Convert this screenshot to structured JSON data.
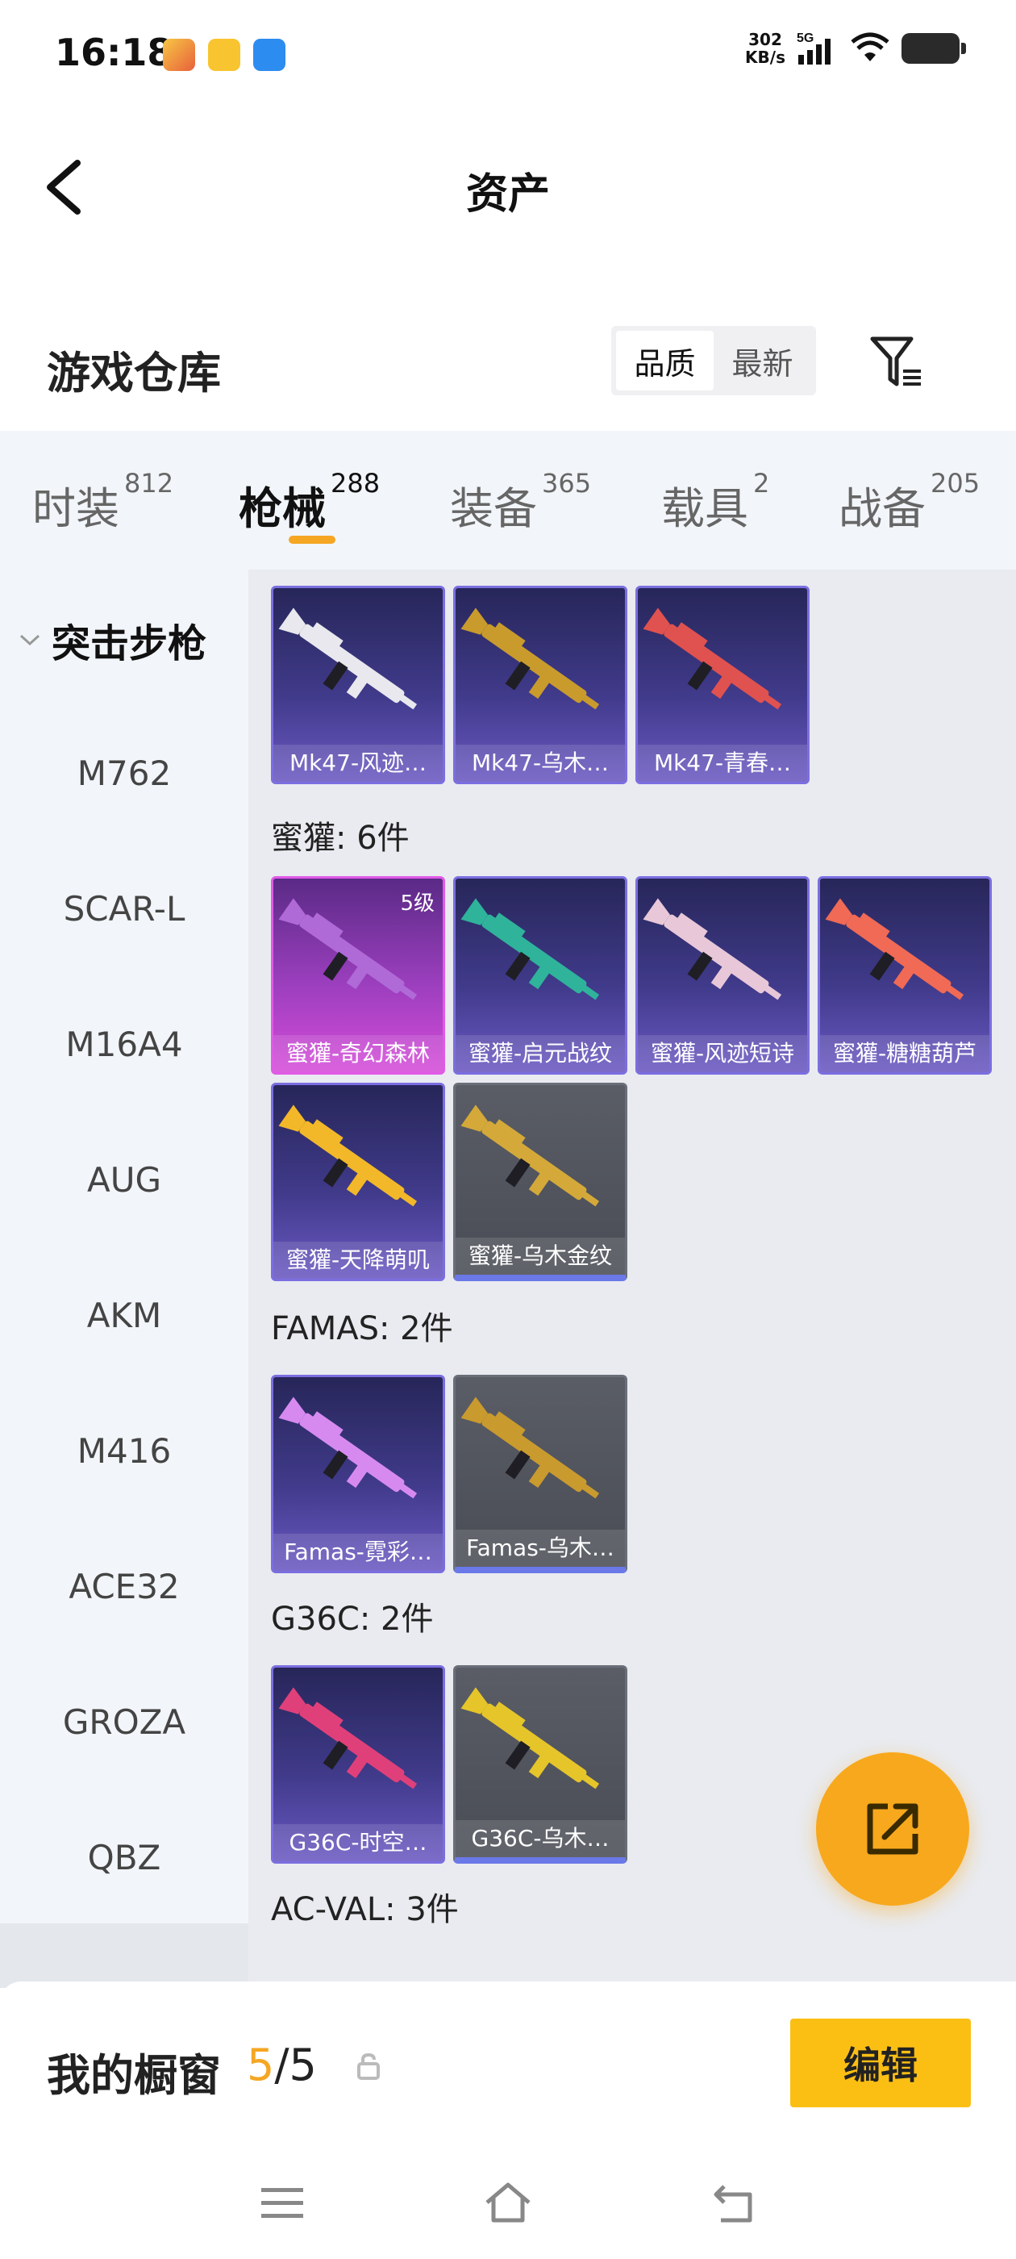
{
  "status": {
    "time": "16:18",
    "net_speed_value": "302",
    "net_speed_unit": "KB/s",
    "network": "5G",
    "app_icons": [
      "app-icon-1",
      "app-icon-2",
      "app-icon-3"
    ]
  },
  "header": {
    "title": "资产",
    "back_icon": "chevron-left-icon"
  },
  "warehouse": {
    "title": "游戏仓库",
    "sort_options": [
      "品质",
      "最新"
    ],
    "sort_selected": "品质",
    "filter_icon": "filter-icon"
  },
  "tabs": [
    {
      "label": "时装",
      "count": "812"
    },
    {
      "label": "枪械",
      "count": "288",
      "active": true
    },
    {
      "label": "装备",
      "count": "365"
    },
    {
      "label": "载具",
      "count": "2"
    },
    {
      "label": "战备",
      "count": "205"
    }
  ],
  "sidenav": {
    "category": "突击步枪",
    "items": [
      "M762",
      "SCAR-L",
      "M16A4",
      "AUG",
      "AKM",
      "M416",
      "ACE32",
      "GROZA",
      "QBZ"
    ]
  },
  "groups": [
    {
      "title": "",
      "items": [
        {
          "name": "Mk47-风迹…",
          "style": "epic"
        },
        {
          "name": "Mk47-乌木…",
          "style": "epic"
        },
        {
          "name": "Mk47-青春…",
          "style": "epic"
        }
      ]
    },
    {
      "title": "蜜獾: 6件",
      "items": [
        {
          "name": "蜜獾-奇幻森林",
          "style": "legend",
          "level": "5级"
        },
        {
          "name": "蜜獾-启元战纹",
          "style": "epic"
        },
        {
          "name": "蜜獾-风迹短诗",
          "style": "epic"
        },
        {
          "name": "蜜獾-糖糖葫芦",
          "style": "epic"
        },
        {
          "name": "蜜獾-天降萌叽",
          "style": "epic"
        },
        {
          "name": "蜜獾-乌木金纹",
          "style": "gray"
        }
      ]
    },
    {
      "title": "FAMAS: 2件",
      "items": [
        {
          "name": "Famas-霓彩…",
          "style": "epic"
        },
        {
          "name": "Famas-乌木…",
          "style": "gray"
        }
      ]
    },
    {
      "title": "G36C: 2件",
      "items": [
        {
          "name": "G36C-时空…",
          "style": "epic"
        },
        {
          "name": "G36C-乌木…",
          "style": "gray"
        }
      ]
    },
    {
      "title": "AC-VAL: 3件",
      "items": []
    }
  ],
  "fab": {
    "icon": "share-icon"
  },
  "showcase": {
    "title": "我的橱窗",
    "current": "5",
    "total": "/5",
    "lock_icon": "lock-icon",
    "edit_label": "编辑"
  },
  "navbar": {
    "icons": [
      "menu-icon",
      "home-icon",
      "back-icon"
    ]
  },
  "colors": {
    "accent": "#f5a623",
    "button": "#fbbf14",
    "epic": "#6a58c2",
    "legend": "#d64bd9"
  }
}
